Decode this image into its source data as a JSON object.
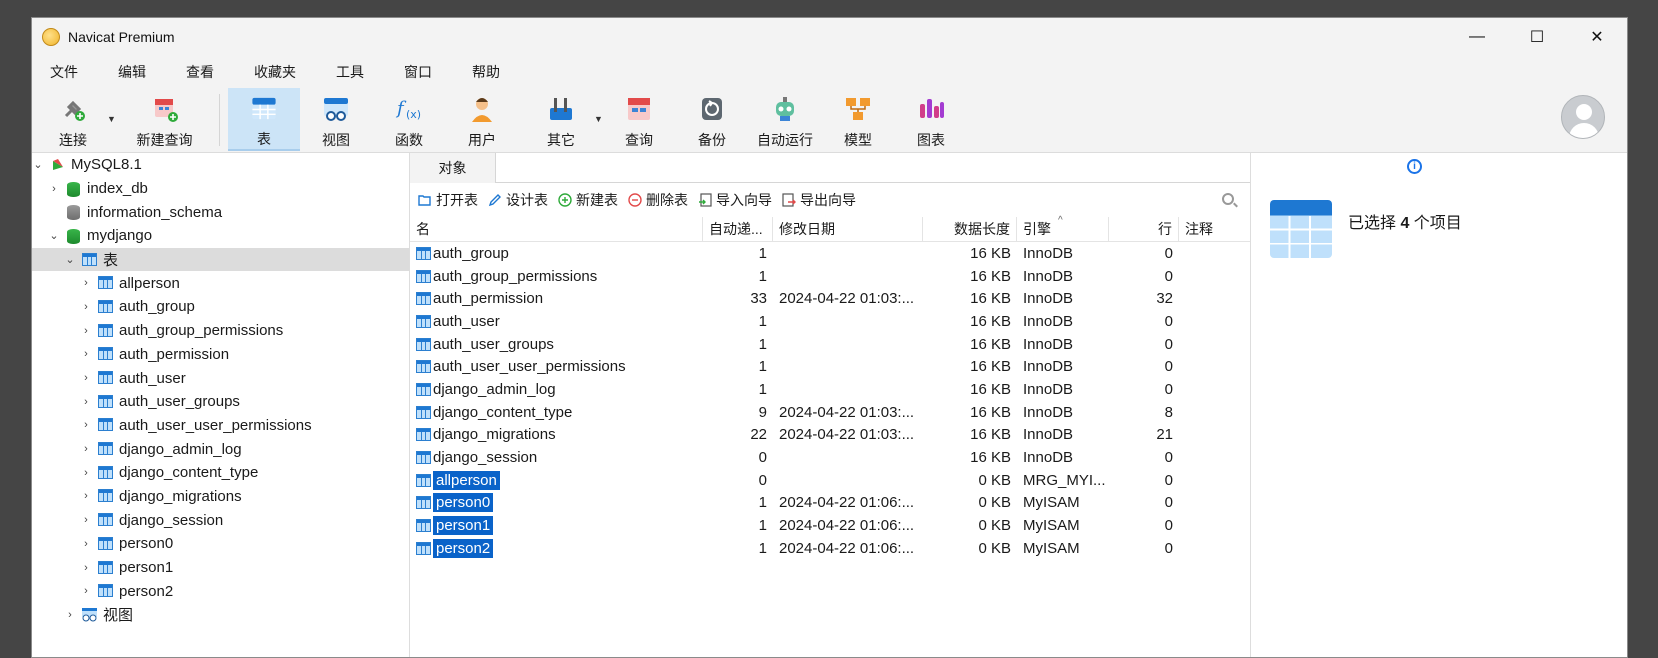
{
  "window": {
    "title": "Navicat Premium",
    "minimize": "—",
    "maximize": "☐",
    "close": "✕"
  },
  "menu": [
    "文件",
    "编辑",
    "查看",
    "收藏夹",
    "工具",
    "窗口",
    "帮助"
  ],
  "toolbar": {
    "connect": "连接",
    "new_query": "新建查询",
    "table": "表",
    "view": "视图",
    "function": "函数",
    "user": "用户",
    "other": "其它",
    "query": "查询",
    "backup": "备份",
    "automation": "自动运行",
    "model": "模型",
    "chart": "图表"
  },
  "tree": {
    "connection": "MySQL8.1",
    "dbs": [
      "index_db",
      "information_schema",
      "mydjango"
    ],
    "tables_node": "表",
    "tables": [
      "allperson",
      "auth_group",
      "auth_group_permissions",
      "auth_permission",
      "auth_user",
      "auth_user_groups",
      "auth_user_user_permissions",
      "django_admin_log",
      "django_content_type",
      "django_migrations",
      "django_session",
      "person0",
      "person1",
      "person2"
    ],
    "views_node": "视图"
  },
  "tabs": {
    "objects": "对象"
  },
  "actions": {
    "open": "打开表",
    "design": "设计表",
    "new": "新建表",
    "delete": "删除表",
    "import": "导入向导",
    "export": "导出向导"
  },
  "columns": {
    "name": "名",
    "auto_inc": "自动递...",
    "modified": "修改日期",
    "data_len": "数据长度",
    "engine": "引擎",
    "rows": "行",
    "comment": "注释"
  },
  "rows": [
    {
      "name": "auth_group",
      "auto": "1",
      "date": "",
      "len": "16 KB",
      "engine": "InnoDB",
      "rows": "0",
      "selected": false
    },
    {
      "name": "auth_group_permissions",
      "auto": "1",
      "date": "",
      "len": "16 KB",
      "engine": "InnoDB",
      "rows": "0",
      "selected": false
    },
    {
      "name": "auth_permission",
      "auto": "33",
      "date": "2024-04-22 01:03:...",
      "len": "16 KB",
      "engine": "InnoDB",
      "rows": "32",
      "selected": false
    },
    {
      "name": "auth_user",
      "auto": "1",
      "date": "",
      "len": "16 KB",
      "engine": "InnoDB",
      "rows": "0",
      "selected": false
    },
    {
      "name": "auth_user_groups",
      "auto": "1",
      "date": "",
      "len": "16 KB",
      "engine": "InnoDB",
      "rows": "0",
      "selected": false
    },
    {
      "name": "auth_user_user_permissions",
      "auto": "1",
      "date": "",
      "len": "16 KB",
      "engine": "InnoDB",
      "rows": "0",
      "selected": false
    },
    {
      "name": "django_admin_log",
      "auto": "1",
      "date": "",
      "len": "16 KB",
      "engine": "InnoDB",
      "rows": "0",
      "selected": false
    },
    {
      "name": "django_content_type",
      "auto": "9",
      "date": "2024-04-22 01:03:...",
      "len": "16 KB",
      "engine": "InnoDB",
      "rows": "8",
      "selected": false
    },
    {
      "name": "django_migrations",
      "auto": "22",
      "date": "2024-04-22 01:03:...",
      "len": "16 KB",
      "engine": "InnoDB",
      "rows": "21",
      "selected": false
    },
    {
      "name": "django_session",
      "auto": "0",
      "date": "",
      "len": "16 KB",
      "engine": "InnoDB",
      "rows": "0",
      "selected": false
    },
    {
      "name": "allperson",
      "auto": "0",
      "date": "",
      "len": "0 KB",
      "engine": "MRG_MYI...",
      "rows": "0",
      "selected": true
    },
    {
      "name": "person0",
      "auto": "1",
      "date": "2024-04-22 01:06:...",
      "len": "0 KB",
      "engine": "MyISAM",
      "rows": "0",
      "selected": true
    },
    {
      "name": "person1",
      "auto": "1",
      "date": "2024-04-22 01:06:...",
      "len": "0 KB",
      "engine": "MyISAM",
      "rows": "0",
      "selected": true
    },
    {
      "name": "person2",
      "auto": "1",
      "date": "2024-04-22 01:06:...",
      "len": "0 KB",
      "engine": "MyISAM",
      "rows": "0",
      "selected": true
    }
  ],
  "info": {
    "prefix": "已选择 ",
    "count": "4",
    "suffix": " 个项目",
    "icon": "i"
  }
}
